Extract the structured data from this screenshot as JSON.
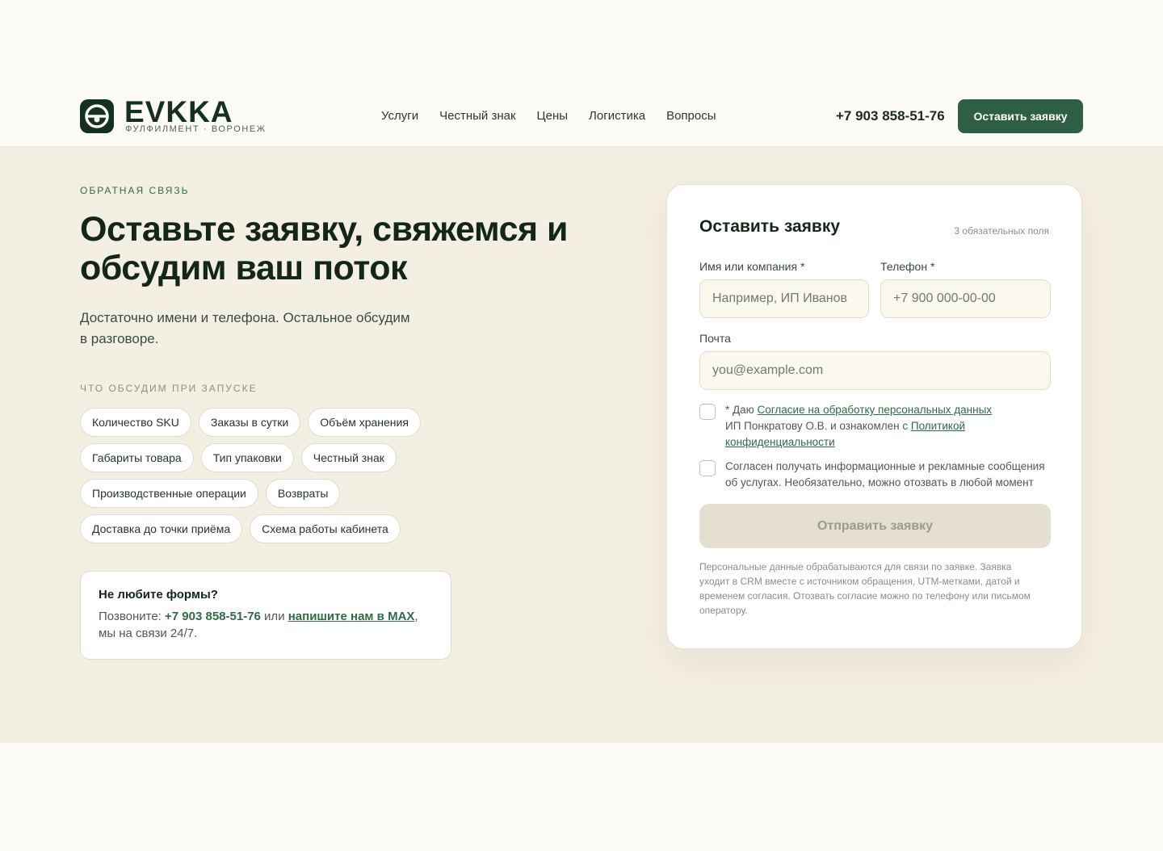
{
  "brand": {
    "name": "EVKKA",
    "tagline": "ФУЛФИЛМЕНТ · ВОРОНЕЖ"
  },
  "nav": {
    "items": [
      "Услуги",
      "Честный знак",
      "Цены",
      "Логистика",
      "Вопросы"
    ]
  },
  "header": {
    "phone": "+7 903 858-51-76",
    "cta_label": "Оставить заявку"
  },
  "hero": {
    "eyebrow": "ОБРАТНАЯ СВЯЗЬ",
    "title": "Оставьте заявку, свяжемся и обсудим ваш поток",
    "subtitle": "Достаточно имени и телефона. Остальное обсудим в разговоре.",
    "chips_label": "ЧТО ОБСУДИМ ПРИ ЗАПУСКЕ",
    "chips": [
      [
        "Количество SKU",
        "Заказы в сутки",
        "Объём хранения"
      ],
      [
        "Габариты товара",
        "Тип упаковки",
        "Честный знак"
      ],
      [
        "Производственные операции",
        "Возвраты"
      ],
      [
        "Доставка до точки приёма",
        "Схема работы кабинета"
      ]
    ]
  },
  "no_forms": {
    "title": "Не любите формы?",
    "prefix": "Позвоните: ",
    "phone": "+7 903 858-51-76",
    "middle": " или ",
    "link": "напишите нам в MAX",
    "suffix_1": ",",
    "suffix_2": "мы на связи 24/7."
  },
  "form": {
    "title": "Оставить заявку",
    "required_note": "3 обязательных поля",
    "name_label": "Имя или компания *",
    "name_placeholder": "Например, ИП Иванов",
    "name_value": "",
    "phone_label": "Телефон *",
    "phone_placeholder": "+7 900 000-00-00",
    "phone_value": "",
    "email_label": "Почта",
    "email_placeholder": "you@example.com",
    "email_value": "",
    "consent_prefix": "* Даю ",
    "consent_link": "Согласие на обработку персональных данных",
    "consent_middle": "ИП Понкратову О.В. и ознакомлен с ",
    "consent_policy_link": "Политикой конфиденциальности",
    "marketing_text": "Согласен получать информационные и рекламные сообщения об услугах. Необязательно, можно отозвать в любой момент",
    "submit_label": "Отправить заявку",
    "disclaimer": "Персональные данные обрабатываются для связи по заявке. Заявка уходит в CRM вместе с источником обращения, UTM-метками, датой и временем согласия. Отозвать согласие можно по телефону или письмом оператору."
  },
  "colors": {
    "accent": "#2e5f44",
    "brand_dark": "#15301f",
    "section_bg": "#f4efe3",
    "page_bg": "#fcfbf5"
  }
}
